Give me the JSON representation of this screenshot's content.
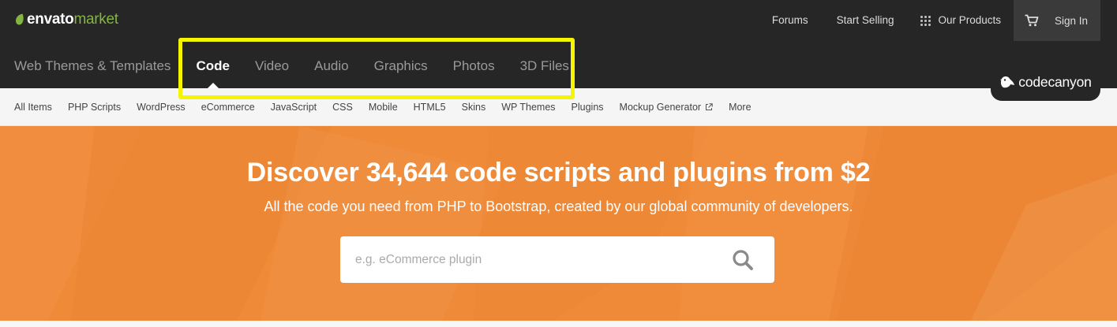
{
  "header": {
    "logo": {
      "word1": "envato",
      "word2": "market"
    },
    "links": {
      "forums": "Forums",
      "start_selling": "Start Selling",
      "our_products": "Our Products",
      "sign_in": "Sign In"
    }
  },
  "category_nav": {
    "items": [
      {
        "label": "Web Themes & Templates",
        "active": false
      },
      {
        "label": "Code",
        "active": true
      },
      {
        "label": "Video",
        "active": false
      },
      {
        "label": "Audio",
        "active": false
      },
      {
        "label": "Graphics",
        "active": false
      },
      {
        "label": "Photos",
        "active": false
      },
      {
        "label": "3D Files",
        "active": false
      }
    ]
  },
  "badge": {
    "text": "codecanyon"
  },
  "subnav": {
    "items": [
      "All Items",
      "PHP Scripts",
      "WordPress",
      "eCommerce",
      "JavaScript",
      "CSS",
      "Mobile",
      "HTML5",
      "Skins",
      "WP Themes",
      "Plugins",
      "Mockup Generator",
      "More"
    ]
  },
  "hero": {
    "title": "Discover 34,644 code scripts and plugins from $2",
    "subtitle": "All the code you need from PHP to Bootstrap, created by our global community of developers.",
    "search_placeholder": "e.g. eCommerce plugin"
  },
  "colors": {
    "topbar": "#262626",
    "brand_green": "#82b541",
    "hero_orange": "#ef8a38",
    "highlight": "#f5f500"
  },
  "icons": [
    "envato-leaf-icon",
    "grid-icon",
    "cart-icon",
    "codecanyon-bird-icon",
    "external-link-icon",
    "search-icon"
  ]
}
